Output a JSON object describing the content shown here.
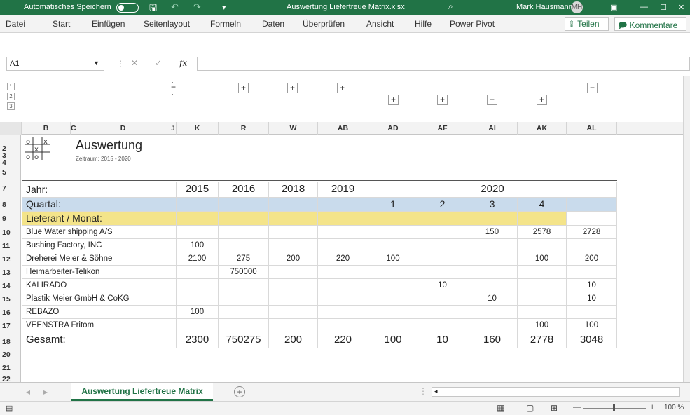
{
  "app": {
    "autosave_label": "Automatisches Speichern",
    "filename": "Auswertung Liefertreue Matrix.xlsx",
    "user": "Mark Hausmann",
    "brand_color": "#217346"
  },
  "menu": {
    "items": [
      "Datei",
      "Start",
      "Einfügen",
      "Seitenlayout",
      "Formeln",
      "Daten",
      "Überprüfen",
      "Ansicht",
      "Hilfe",
      "Power Pivot"
    ],
    "share": "Teilen",
    "comments": "Kommentare"
  },
  "formula": {
    "cell_ref": "A1",
    "fx": "fx",
    "content": ""
  },
  "outline": {
    "levels": [
      "1",
      "2",
      "3"
    ],
    "buttons": [
      "−",
      "+",
      "+",
      "+",
      "+",
      "+",
      "+",
      "+",
      "−"
    ]
  },
  "columns": [
    "B",
    "C",
    "D",
    "J",
    "K",
    "R",
    "W",
    "AB",
    "AD",
    "AF",
    "AI",
    "AK",
    "AL"
  ],
  "rows": [
    "2",
    "3",
    "4",
    "5",
    "7",
    "8",
    "9",
    "10",
    "11",
    "12",
    "13",
    "14",
    "15",
    "16",
    "17",
    "18",
    "20",
    "21",
    "22"
  ],
  "header": {
    "title": "Auswertung",
    "period": "Zeitraum: 2015 - 2020",
    "logo": [
      "o",
      "x",
      "x",
      "o",
      "o"
    ]
  },
  "table": {
    "year_label": "Jahr:",
    "quarter_label": "Quartal:",
    "supplier_label": "Lieferant / Monat:",
    "years": [
      "2015",
      "2016",
      "2018",
      "2019",
      "2020"
    ],
    "quarters": [
      "1",
      "2",
      "3",
      "4"
    ],
    "suppliers": [
      {
        "name": "Blue Water shipping A/S",
        "values": [
          "",
          "",
          "",
          "",
          "",
          "",
          "150",
          "2578",
          "2728"
        ]
      },
      {
        "name": "Bushing Factory, INC",
        "values": [
          "100",
          "",
          "",
          "",
          "",
          "",
          "",
          "",
          ""
        ]
      },
      {
        "name": "Dreherei Meier & Söhne",
        "values": [
          "2100",
          "275",
          "200",
          "220",
          "100",
          "",
          "",
          "100",
          "200"
        ]
      },
      {
        "name": "Heimarbeiter-Telikon",
        "values": [
          "",
          "750000",
          "",
          "",
          "",
          "",
          "",
          "",
          ""
        ]
      },
      {
        "name": "KALIRADO",
        "values": [
          "",
          "",
          "",
          "",
          "",
          "10",
          "",
          "",
          "10"
        ]
      },
      {
        "name": "Plastik Meier GmbH & CoKG",
        "values": [
          "",
          "",
          "",
          "",
          "",
          "",
          "10",
          "",
          "10"
        ]
      },
      {
        "name": "REBAZO",
        "values": [
          "100",
          "",
          "",
          "",
          "",
          "",
          "",
          "",
          ""
        ]
      },
      {
        "name": "VEENSTRA Fritom",
        "values": [
          "",
          "",
          "",
          "",
          "",
          "",
          "",
          "100",
          "100"
        ]
      }
    ],
    "total_label": "Gesamt:",
    "totals": [
      "2300",
      "750275",
      "200",
      "220",
      "100",
      "10",
      "160",
      "2778",
      "3048"
    ]
  },
  "tabs": {
    "active": "Auswertung Liefertreue Matrix",
    "add": "+"
  },
  "status": {
    "zoom": "100 %"
  }
}
